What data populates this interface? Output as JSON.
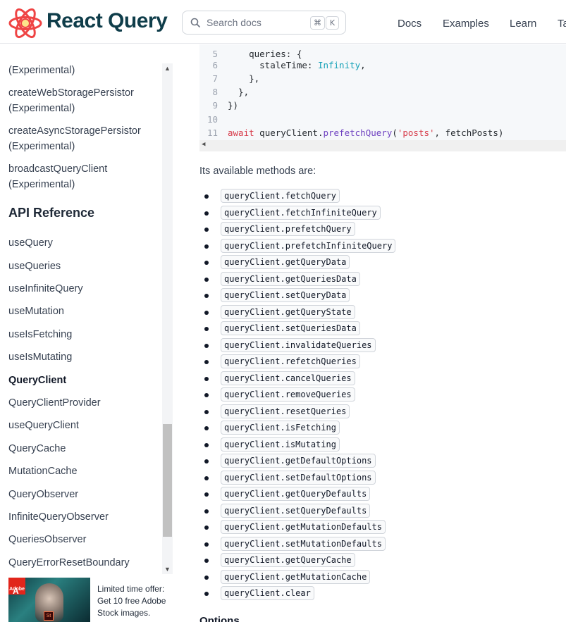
{
  "header": {
    "brand": "React Query",
    "search_placeholder": "Search docs",
    "kbd_cmd": "⌘",
    "kbd_k": "K",
    "nav": [
      "Docs",
      "Examples",
      "Learn",
      "Ta"
    ]
  },
  "sidebar": {
    "items_top": [
      "(Experimental)",
      "createWebStoragePersistor",
      "(Experimental)",
      "createAsyncStoragePersistor",
      "(Experimental)",
      "broadcastQueryClient",
      "(Experimental)"
    ],
    "heading": "API Reference",
    "items": [
      "useQuery",
      "useQueries",
      "useInfiniteQuery",
      "useMutation",
      "useIsFetching",
      "useIsMutating",
      "QueryClient",
      "QueryClientProvider",
      "useQueryClient",
      "QueryCache",
      "MutationCache",
      "QueryObserver",
      "InfiniteQueryObserver",
      "QueriesObserver",
      "QueryErrorResetBoundary"
    ],
    "active_item": "QueryClient"
  },
  "ad": {
    "text": "Limited time offer: Get 10 free Adobe Stock images.",
    "logo_label": "Adobe",
    "st_label": "St"
  },
  "code": {
    "lines": [
      {
        "n": "5",
        "text": "    queries: {"
      },
      {
        "n": "6",
        "text": "      staleTime: Infinity,"
      },
      {
        "n": "7",
        "text": "    },"
      },
      {
        "n": "8",
        "text": "  },"
      },
      {
        "n": "9",
        "text": "})"
      },
      {
        "n": "10",
        "text": ""
      },
      {
        "n": "11",
        "text": "await queryClient.prefetchQuery('posts', fetchPosts)"
      }
    ]
  },
  "content": {
    "intro": "Its available methods are:",
    "methods": [
      "queryClient.fetchQuery",
      "queryClient.fetchInfiniteQuery",
      "queryClient.prefetchQuery",
      "queryClient.prefetchInfiniteQuery",
      "queryClient.getQueryData",
      "queryClient.getQueriesData",
      "queryClient.setQueryData",
      "queryClient.getQueryState",
      "queryClient.setQueriesData",
      "queryClient.invalidateQueries",
      "queryClient.refetchQueries",
      "queryClient.cancelQueries",
      "queryClient.removeQueries",
      "queryClient.resetQueries",
      "queryClient.isFetching",
      "queryClient.isMutating",
      "queryClient.getDefaultOptions",
      "queryClient.setDefaultOptions",
      "queryClient.getQueryDefaults",
      "queryClient.setQueryDefaults",
      "queryClient.getMutationDefaults",
      "queryClient.setMutationDefaults",
      "queryClient.getQueryCache",
      "queryClient.getMutationCache",
      "queryClient.clear"
    ],
    "next_heading": "Options"
  },
  "colors": {
    "brand": "#0f3d4a",
    "logo": "#ef4444",
    "code_bg": "#f6f8fa"
  }
}
